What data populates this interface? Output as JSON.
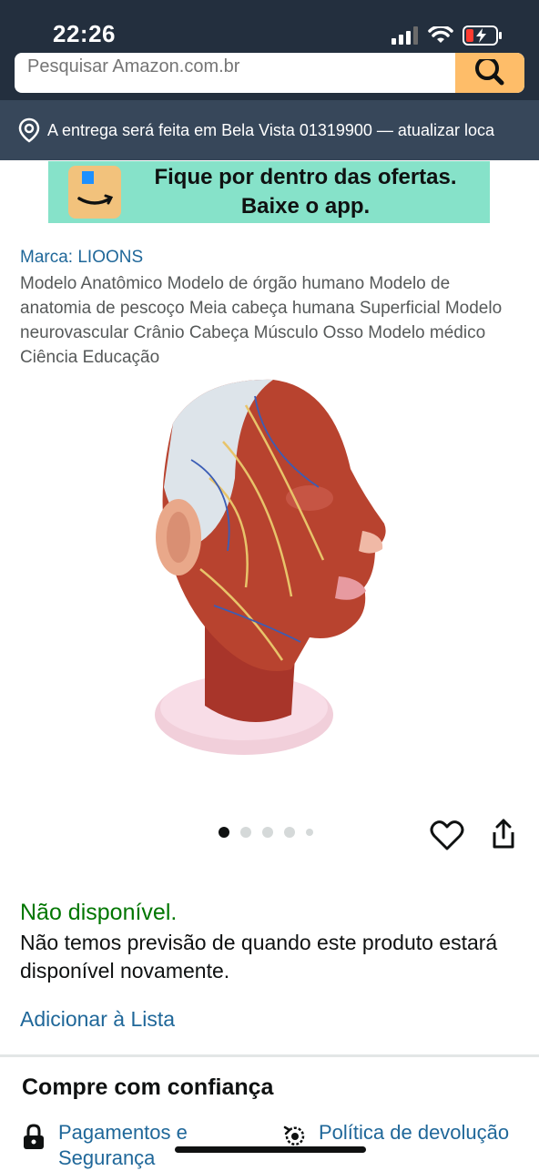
{
  "status_bar": {
    "time": "22:26"
  },
  "search": {
    "placeholder": "Pesquisar Amazon.com.br"
  },
  "delivery": {
    "text": "A entrega será feita em Bela Vista 01319900 — atualizar loca"
  },
  "banner": {
    "line1": "Fique por dentro das ofertas.",
    "line2": "Baixe o app."
  },
  "product": {
    "brand": "Marca: LIOONS",
    "title": "Modelo Anatômico Modelo de órgão humano Modelo de anatomia de pescoço Meia cabeça humana Superficial Modelo neurovascular Crânio Cabeça Músculo Osso Modelo médico Ciência Educação",
    "image_description_icon": "anatomical-head-model-image",
    "carousel": {
      "total_dots": 5,
      "active_index": 0
    }
  },
  "availability": {
    "status": "Não disponível.",
    "description": "Não temos previsão de quando este produto estará disponível novamente."
  },
  "actions": {
    "add_to_list": "Adicionar à Lista"
  },
  "trust": {
    "title": "Compre com confiança",
    "payments_label": "Pagamentos e Segurança",
    "return_label": "Política de devolução"
  },
  "colors": {
    "header": "#232f3e",
    "delivery_bar": "#37475a",
    "search_button": "#febd69",
    "link": "#1f6799",
    "in_stock_green": "#007600",
    "banner_bg": "#86e2c9"
  }
}
